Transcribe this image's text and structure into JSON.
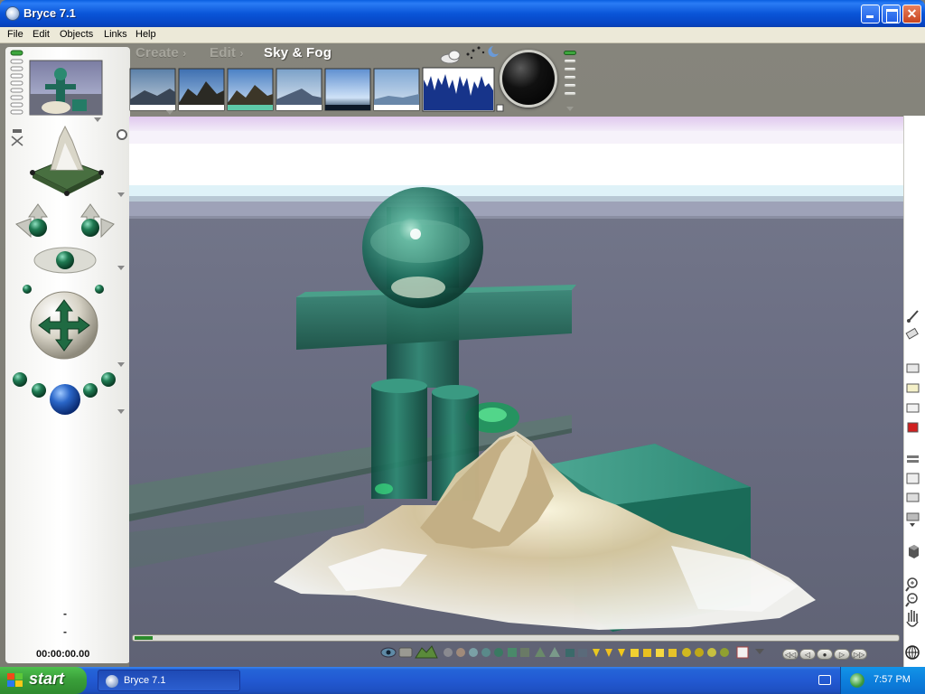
{
  "window": {
    "title": "Bryce 7.1",
    "controls": {
      "minimize": "",
      "maximize": "",
      "close": "✕"
    }
  },
  "menu": {
    "items": [
      "File",
      "Edit",
      "Objects",
      "Links",
      "Help"
    ]
  },
  "palette": {
    "tabs": [
      {
        "label": "Create",
        "arrow": "›",
        "active": false
      },
      {
        "label": "Edit",
        "arrow": "›",
        "active": false
      },
      {
        "label": "Sky & Fog",
        "active": true
      }
    ],
    "presets": [
      {
        "name": "sky-preset-1",
        "sky": "#8aa6c4",
        "ground": "#4e5b6a"
      },
      {
        "name": "sky-preset-2",
        "sky": "#6f9ac9",
        "ground": "#3f3a32"
      },
      {
        "name": "sky-preset-3",
        "sky": "#7aa8d8",
        "ground": "#4a4438"
      },
      {
        "name": "sky-preset-4",
        "sky": "#a7c4e0",
        "ground": "#5a6b80"
      },
      {
        "name": "sky-preset-5",
        "sky": "#9ec3ea",
        "ground": "#20324a"
      },
      {
        "name": "sky-preset-6",
        "sky": "#b9cde3",
        "ground": "#6a88aa"
      }
    ],
    "dial": "sun-moon-dial"
  },
  "timeline": {
    "timecode": "00:00:00.00"
  },
  "left_panel": {
    "markers": [
      "-",
      "-"
    ]
  },
  "nav_buttons": [
    "◁◁",
    "◁",
    "●",
    "▷",
    "▷▷"
  ],
  "taskbar": {
    "start_label": "start",
    "task_label": "Bryce 7.1",
    "clock": "7:57 PM"
  },
  "colors": {
    "titlebar": "#0a55d8",
    "taskbar": "#2259d2",
    "start_green": "#3aa03a",
    "app_bg": "#7b7a72",
    "teal_glass": "#1e7a66"
  }
}
